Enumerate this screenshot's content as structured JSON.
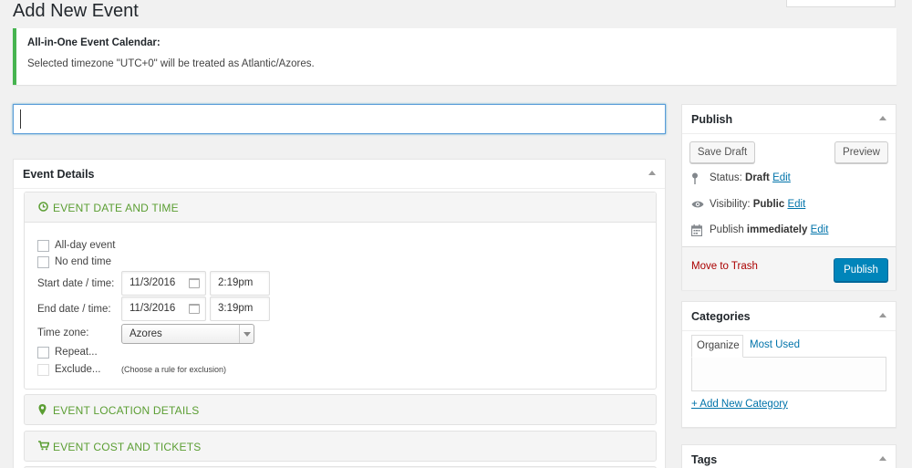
{
  "page": {
    "title": "Add New Event"
  },
  "notice": {
    "heading": "All-in-One Event Calendar:",
    "message": "Selected timezone \"UTC+0\" will be treated as Atlantic/Azores."
  },
  "title_input": {
    "value": "",
    "placeholder": ""
  },
  "event_details": {
    "title": "Event Details",
    "sections": {
      "date_time": {
        "title": "EVENT DATE AND TIME",
        "icon": "clock-icon"
      },
      "location": {
        "title": "EVENT LOCATION DETAILS",
        "icon": "map-marker-icon"
      },
      "cost": {
        "title": "EVENT COST AND TICKETS",
        "icon": "shopping-cart-icon"
      }
    },
    "all_day_label": "All-day event",
    "no_end_label": "No end time",
    "start_label": "Start date / time:",
    "start_date": "11/3/2016",
    "start_time": "2:19pm",
    "end_label": "End date / time:",
    "end_date": "11/3/2016",
    "end_time": "3:19pm",
    "timezone_label": "Time zone:",
    "timezone_value": "Azores",
    "repeat_label": "Repeat...",
    "exclude_label": "Exclude...",
    "exclude_hint": "(Choose a rule for exclusion)"
  },
  "publish": {
    "title": "Publish",
    "save_draft": "Save Draft",
    "preview": "Preview",
    "status_label": "Status:",
    "status_value": "Draft",
    "visibility_label": "Visibility:",
    "visibility_value": "Public",
    "publish_label": "Publish",
    "publish_value": "immediately",
    "edit": "Edit",
    "trash": "Move to Trash",
    "publish_button": "Publish",
    "accent": "#0085ba"
  },
  "categories": {
    "title": "Categories",
    "tab_organize": "Organize",
    "tab_most_used": "Most Used",
    "add_new": "+ Add New Category"
  },
  "tags": {
    "title": "Tags"
  },
  "colors": {
    "section_green": "#5b9e33",
    "notice_green": "#46b450",
    "link": "#0073aa",
    "trash": "#a00"
  }
}
